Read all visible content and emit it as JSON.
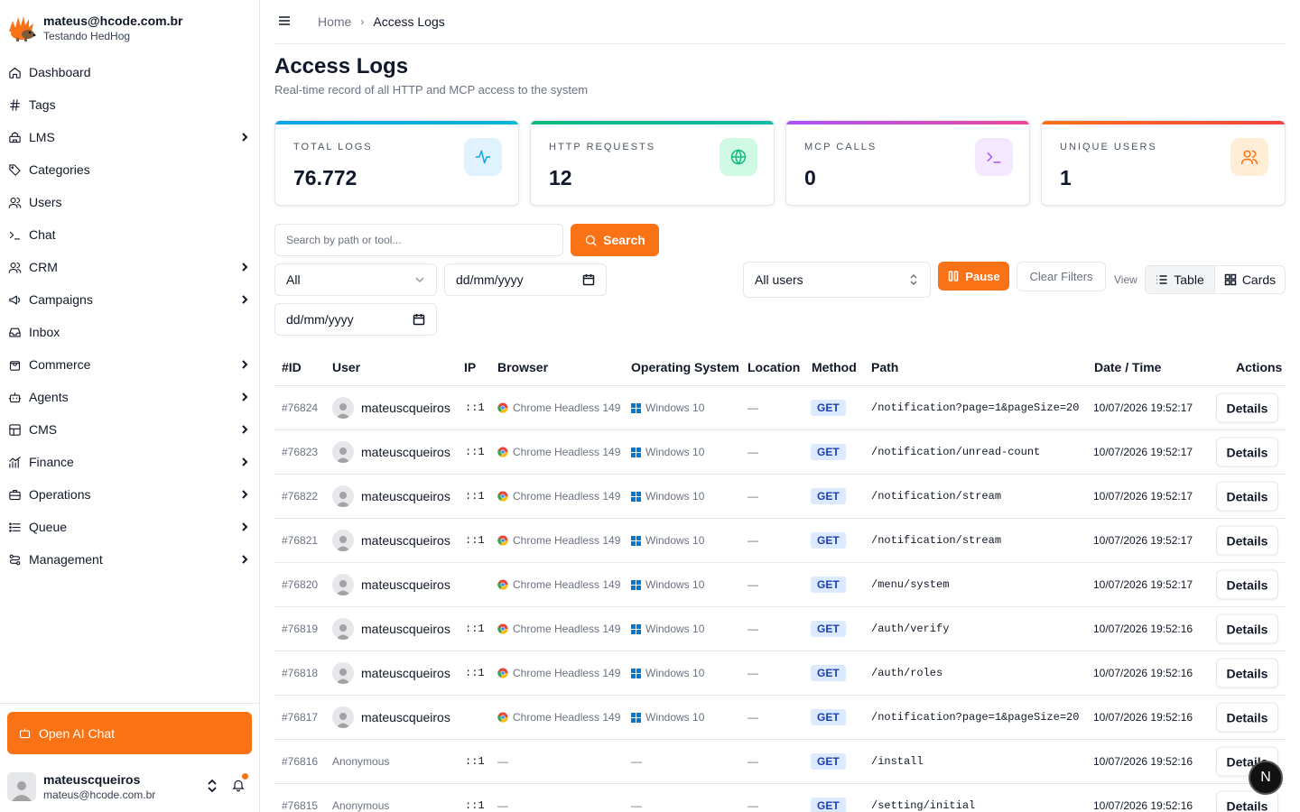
{
  "brand": {
    "email": "mateus@hcode.com.br",
    "subtitle": "Testando HedHog"
  },
  "nav": [
    {
      "label": "Dashboard",
      "icon": "home-icon",
      "chevron": false
    },
    {
      "label": "Tags",
      "icon": "hash-icon",
      "chevron": false
    },
    {
      "label": "LMS",
      "icon": "graduation-icon",
      "chevron": true
    },
    {
      "label": "Categories",
      "icon": "tag-icon",
      "chevron": false
    },
    {
      "label": "Users",
      "icon": "users-icon",
      "chevron": false
    },
    {
      "label": "Chat",
      "icon": "terminal-icon",
      "chevron": false
    },
    {
      "label": "CRM",
      "icon": "users-icon",
      "chevron": true
    },
    {
      "label": "Campaigns",
      "icon": "megaphone-icon",
      "chevron": true
    },
    {
      "label": "Inbox",
      "icon": "inbox-icon",
      "chevron": false
    },
    {
      "label": "Commerce",
      "icon": "bag-icon",
      "chevron": true
    },
    {
      "label": "Agents",
      "icon": "bot-icon",
      "chevron": true
    },
    {
      "label": "CMS",
      "icon": "layout-icon",
      "chevron": true
    },
    {
      "label": "Finance",
      "icon": "chart-icon",
      "chevron": true
    },
    {
      "label": "Operations",
      "icon": "briefcase-icon",
      "chevron": true
    },
    {
      "label": "Queue",
      "icon": "list-icon",
      "chevron": true
    },
    {
      "label": "Management",
      "icon": "route-icon",
      "chevron": true
    }
  ],
  "ai_chat_label": "Open AI Chat",
  "current_user": {
    "name": "mateuscqueiros",
    "email": "mateus@hcode.com.br"
  },
  "breadcrumb": {
    "home": "Home",
    "current": "Access Logs"
  },
  "page": {
    "title": "Access Logs",
    "subtitle": "Real-time record of all HTTP and MCP access to the system"
  },
  "stats": [
    {
      "key": "TOTAL LOGS",
      "value": "76.772",
      "icon": "activity-icon",
      "color": "#0ea5e9"
    },
    {
      "key": "HTTP REQUESTS",
      "value": "12",
      "icon": "globe-icon",
      "color": "#10b981"
    },
    {
      "key": "MCP CALLS",
      "value": "0",
      "icon": "terminal-icon",
      "color": "#a855f7"
    },
    {
      "key": "UNIQUE USERS",
      "value": "1",
      "icon": "users-icon",
      "color": "#f97316"
    }
  ],
  "filters": {
    "search_placeholder": "Search by path or tool...",
    "search_button": "Search",
    "method_select": "All",
    "date_from_placeholder": "dd/mm/yyyy",
    "date_to_placeholder": "dd/mm/yyyy",
    "user_select": "All users",
    "pause_button": "Pause",
    "clear_button": "Clear Filters",
    "view_label": "View",
    "view_table": "Table",
    "view_cards": "Cards"
  },
  "table": {
    "headers": [
      "#ID",
      "User",
      "IP",
      "Browser",
      "Operating System",
      "Location",
      "Method",
      "Path",
      "Date / Time",
      "Actions"
    ],
    "rows": [
      {
        "id": "#76824",
        "user": "mateuscqueiros",
        "ip": "::1",
        "browser": "Chrome Headless 149",
        "os": "Windows 10",
        "location": "—",
        "method": "GET",
        "path": "/notification?page=1&pageSize=20",
        "date": "10/07/2026 19:52:17",
        "action": "Details"
      },
      {
        "id": "#76823",
        "user": "mateuscqueiros",
        "ip": "::1",
        "browser": "Chrome Headless 149",
        "os": "Windows 10",
        "location": "—",
        "method": "GET",
        "path": "/notification/unread-count",
        "date": "10/07/2026 19:52:17",
        "action": "Details"
      },
      {
        "id": "#76822",
        "user": "mateuscqueiros",
        "ip": "::1",
        "browser": "Chrome Headless 149",
        "os": "Windows 10",
        "location": "—",
        "method": "GET",
        "path": "/notification/stream",
        "date": "10/07/2026 19:52:17",
        "action": "Details"
      },
      {
        "id": "#76821",
        "user": "mateuscqueiros",
        "ip": "::1",
        "browser": "Chrome Headless 149",
        "os": "Windows 10",
        "location": "—",
        "method": "GET",
        "path": "/notification/stream",
        "date": "10/07/2026 19:52:17",
        "action": "Details"
      },
      {
        "id": "#76820",
        "user": "mateuscqueiros",
        "ip": "",
        "browser": "Chrome Headless 149",
        "os": "Windows 10",
        "location": "—",
        "method": "GET",
        "path": "/menu/system",
        "date": "10/07/2026 19:52:17",
        "action": "Details"
      },
      {
        "id": "#76819",
        "user": "mateuscqueiros",
        "ip": "::1",
        "browser": "Chrome Headless 149",
        "os": "Windows 10",
        "location": "—",
        "method": "GET",
        "path": "/auth/verify",
        "date": "10/07/2026 19:52:16",
        "action": "Details"
      },
      {
        "id": "#76818",
        "user": "mateuscqueiros",
        "ip": "::1",
        "browser": "Chrome Headless 149",
        "os": "Windows 10",
        "location": "—",
        "method": "GET",
        "path": "/auth/roles",
        "date": "10/07/2026 19:52:16",
        "action": "Details"
      },
      {
        "id": "#76817",
        "user": "mateuscqueiros",
        "ip": "",
        "browser": "Chrome Headless 149",
        "os": "Windows 10",
        "location": "—",
        "method": "GET",
        "path": "/notification?page=1&pageSize=20",
        "date": "10/07/2026 19:52:16",
        "action": "Details"
      },
      {
        "id": "#76816",
        "user": "Anonymous",
        "ip": "::1",
        "browser": "—",
        "os": "—",
        "location": "—",
        "method": "GET",
        "path": "/install",
        "date": "10/07/2026 19:52:16",
        "action": "Details"
      },
      {
        "id": "#76815",
        "user": "Anonymous",
        "ip": "::1",
        "browser": "—",
        "os": "—",
        "location": "—",
        "method": "GET",
        "path": "/setting/initial",
        "date": "10/07/2026 19:52:16",
        "action": "Details"
      }
    ]
  },
  "fab_label": "N",
  "colors": {
    "accent": "#f97316",
    "method_bg": "#dbeafe",
    "method_fg": "#1e40af"
  }
}
